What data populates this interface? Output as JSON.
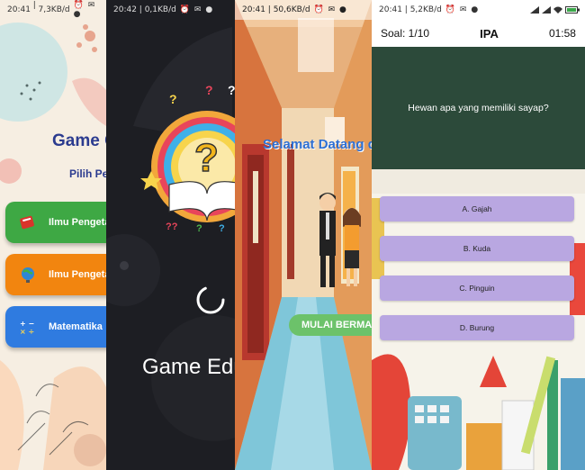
{
  "screen_menu": {
    "status": {
      "time": "20:41",
      "speed": "7,3KB/d"
    },
    "title": "Game G",
    "subtitle": "Pilih Pe",
    "buttons": [
      {
        "label": "Ilmu Pengetah",
        "color": "#3ea844",
        "icon": "book-icon"
      },
      {
        "label": "Ilmu Pengetah",
        "color": "#f2850f",
        "icon": "globe-icon"
      },
      {
        "label": "Matematika",
        "color": "#2f7be0",
        "icon": "math-icon"
      }
    ]
  },
  "screen_splash": {
    "status": {
      "time": "20:42",
      "speed": "0,1KB/d"
    },
    "title": "Game Edu"
  },
  "screen_welcome": {
    "status": {
      "time": "20:41",
      "speed": "50,6KB/d"
    },
    "welcome": "Selamat Datang di",
    "play_label": "MULAI BERMAI"
  },
  "screen_quiz": {
    "status": {
      "time": "20:41",
      "speed": "5,2KB/d"
    },
    "question_counter": "Soal: 1/10",
    "subject": "IPA",
    "timer": "01:58",
    "question": "Hewan apa yang memiliki sayap?",
    "options": [
      "A. Gajah",
      "B. Kuda",
      "C. Pinguin",
      "D. Burung"
    ]
  }
}
